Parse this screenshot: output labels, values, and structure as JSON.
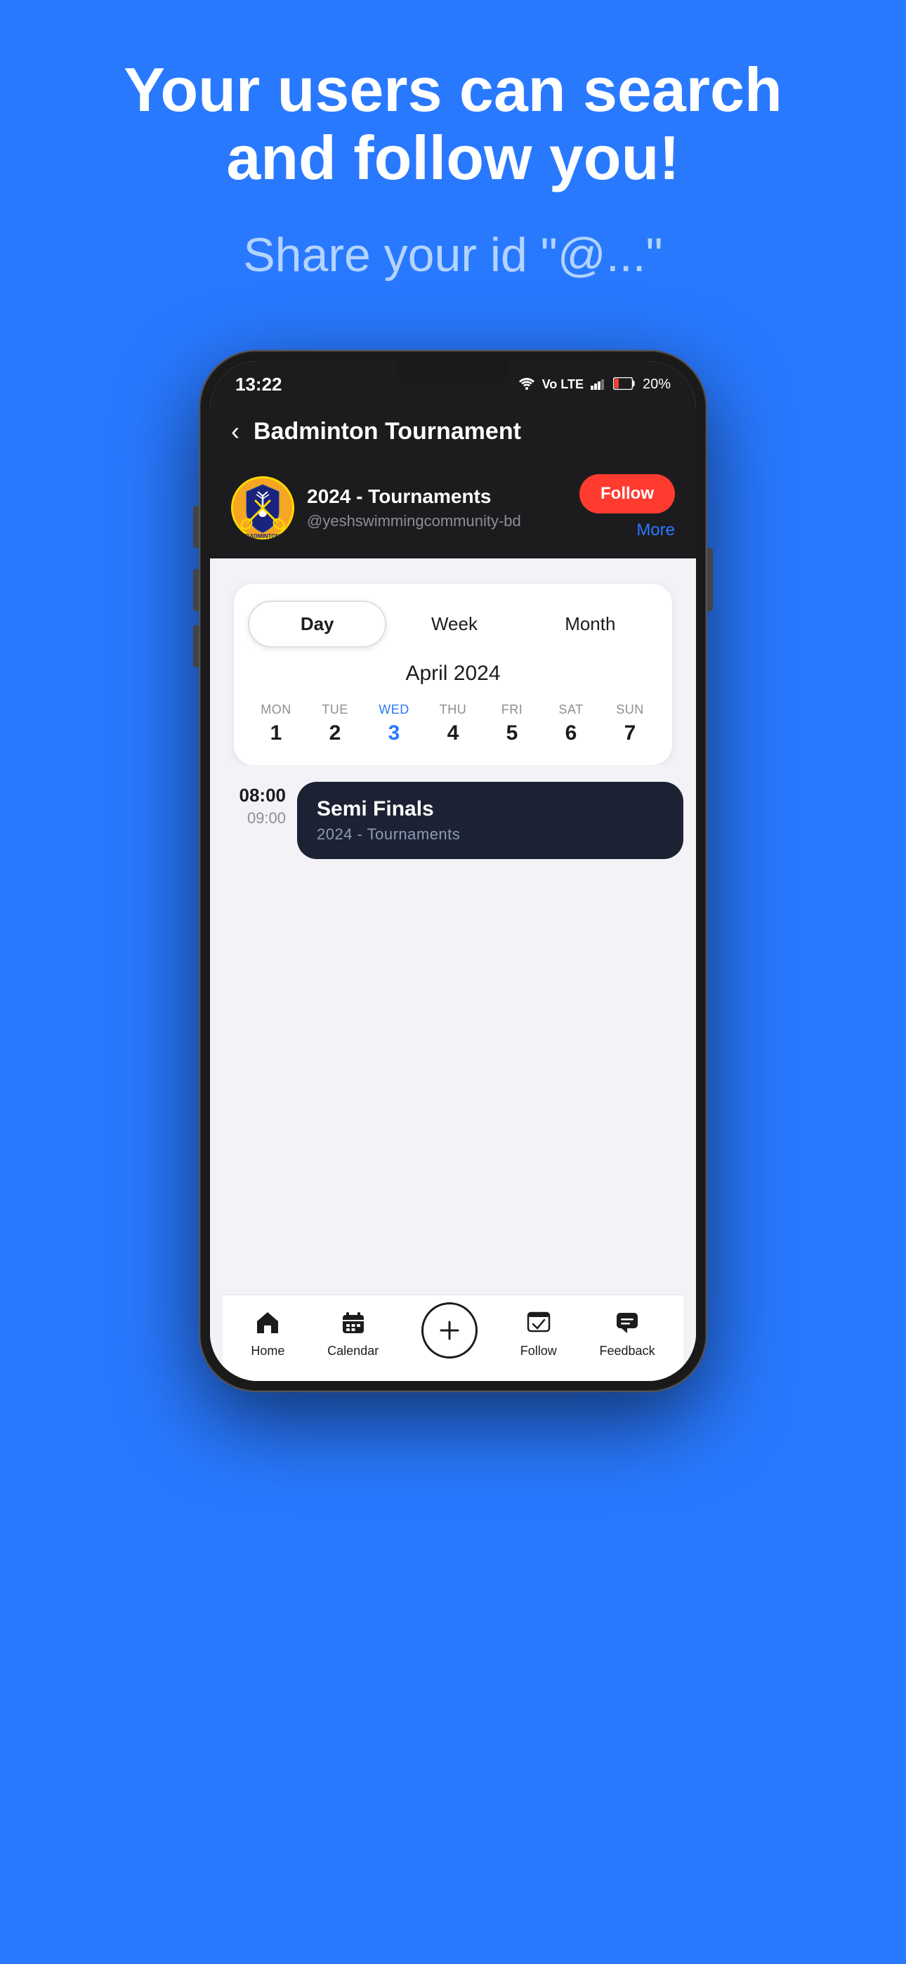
{
  "header": {
    "title_line1": "Your users can search",
    "title_line2": "and follow you!",
    "subtitle": "Share your id \"@...\""
  },
  "status_bar": {
    "time": "13:22",
    "wifi_icon": "wifi",
    "signal_icon": "signal",
    "battery": "20%"
  },
  "nav_header": {
    "back_label": "‹",
    "title": "Badminton Tournament"
  },
  "profile": {
    "name": "2024 - Tournaments",
    "handle": "@yeshswimmingcommunity-bd",
    "follow_label": "Follow",
    "more_label": "More"
  },
  "calendar": {
    "view_tabs": [
      {
        "id": "day",
        "label": "Day",
        "active": true
      },
      {
        "id": "week",
        "label": "Week",
        "active": false
      },
      {
        "id": "month",
        "label": "Month",
        "active": false
      }
    ],
    "month_title": "April 2024",
    "days": [
      {
        "label": "MON",
        "num": "1",
        "highlight": false
      },
      {
        "label": "TUE",
        "num": "2",
        "highlight": false
      },
      {
        "label": "WED",
        "num": "3",
        "highlight": true
      },
      {
        "label": "THU",
        "num": "4",
        "highlight": false
      },
      {
        "label": "FRI",
        "num": "5",
        "highlight": false
      },
      {
        "label": "SAT",
        "num": "6",
        "highlight": false
      },
      {
        "label": "SUN",
        "num": "7",
        "highlight": false
      }
    ],
    "events": [
      {
        "time_start": "08:00",
        "time_end": "09:00",
        "title": "Semi Finals",
        "subtitle": "2024 - Tournaments"
      }
    ]
  },
  "bottom_nav": {
    "items": [
      {
        "id": "home",
        "icon": "🏠",
        "label": "Home"
      },
      {
        "id": "calendar",
        "icon": "📅",
        "label": "Calendar"
      },
      {
        "id": "add",
        "icon": "+",
        "label": ""
      },
      {
        "id": "follow",
        "icon": "✅",
        "label": "Follow"
      },
      {
        "id": "feedback",
        "icon": "💬",
        "label": "Feedback"
      }
    ]
  }
}
